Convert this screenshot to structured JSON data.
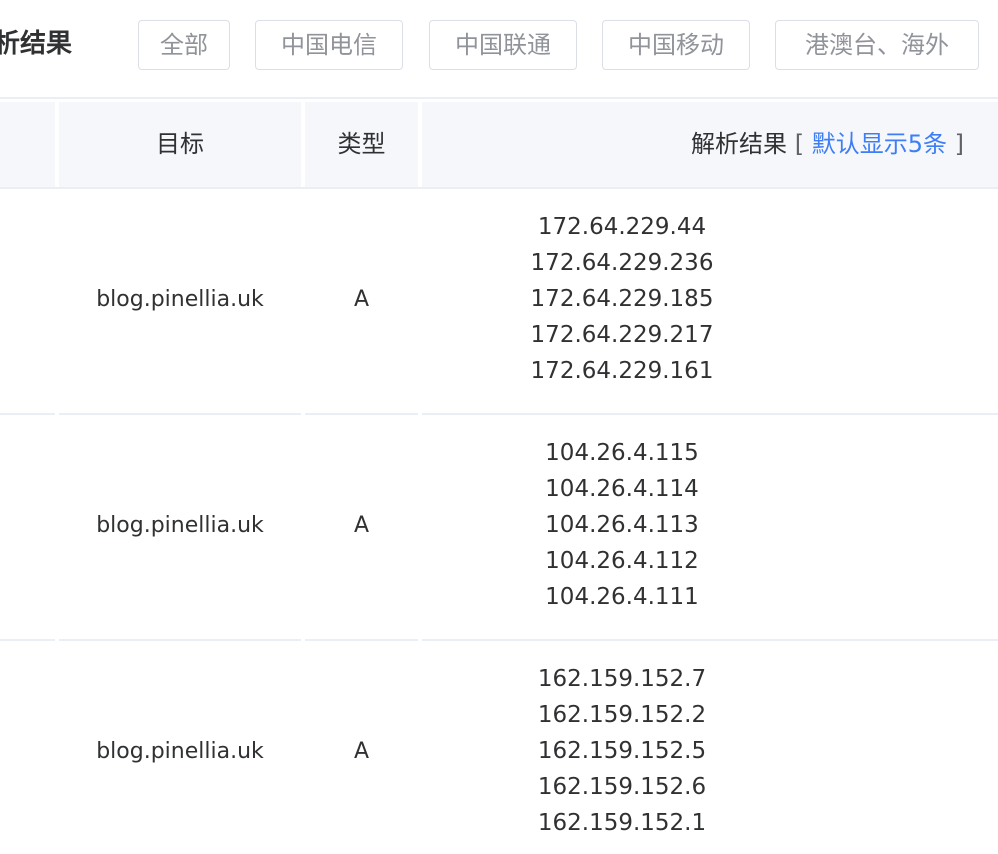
{
  "header": {
    "title": "析结果",
    "tabs": [
      {
        "label": "全部"
      },
      {
        "label": "中国电信"
      },
      {
        "label": "中国联通"
      },
      {
        "label": "中国移动"
      },
      {
        "label": "港澳台、海外"
      }
    ]
  },
  "table": {
    "columns": {
      "target": "目标",
      "type": "类型",
      "result": "解析结果",
      "bracket_open": "[",
      "default_hint": "默认显示5条",
      "bracket_close": "]"
    },
    "rows": [
      {
        "target": "blog.pinellia.uk",
        "type": "A",
        "ips": [
          "172.64.229.44",
          "172.64.229.236",
          "172.64.229.185",
          "172.64.229.217",
          "172.64.229.161"
        ]
      },
      {
        "target": "blog.pinellia.uk",
        "type": "A",
        "ips": [
          "104.26.4.115",
          "104.26.4.114",
          "104.26.4.113",
          "104.26.4.112",
          "104.26.4.111"
        ]
      },
      {
        "target": "blog.pinellia.uk",
        "type": "A",
        "ips": [
          "162.159.152.7",
          "162.159.152.2",
          "162.159.152.5",
          "162.159.152.6",
          "162.159.152.1"
        ]
      }
    ]
  },
  "colors": {
    "accent": "#3d7ef6",
    "header_bg": "#f5f7fa",
    "border": "#ebeef5",
    "tab_text": "#909399"
  }
}
